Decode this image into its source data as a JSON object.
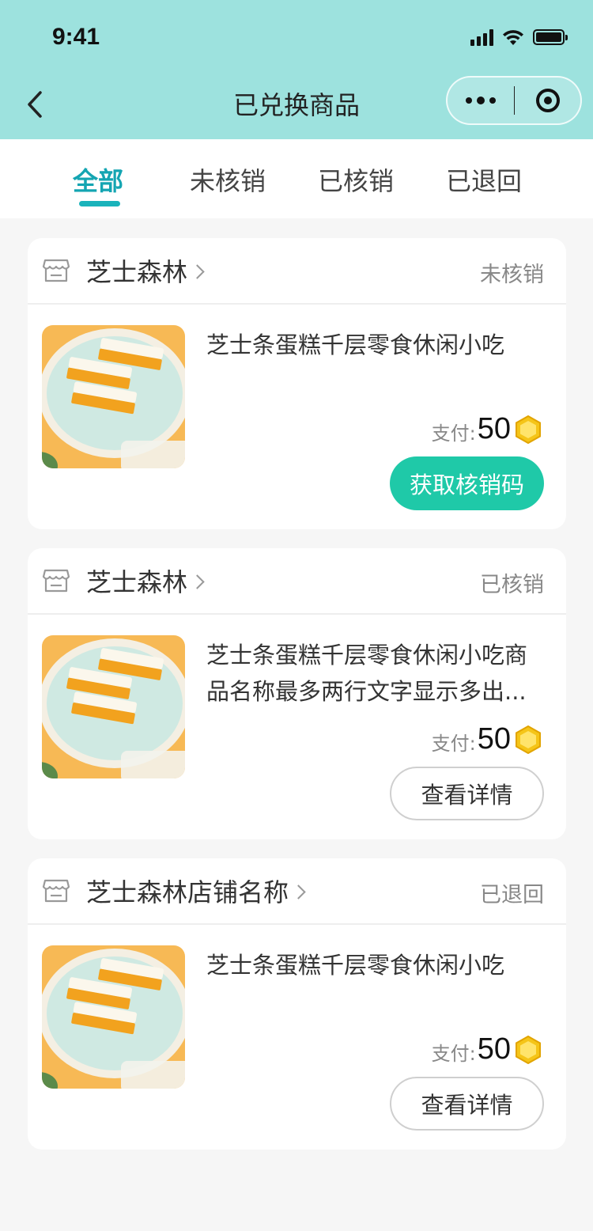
{
  "status_bar": {
    "time": "9:41"
  },
  "nav": {
    "title": "已兑换商品"
  },
  "tabs": [
    {
      "label": "全部",
      "active": true
    },
    {
      "label": "未核销",
      "active": false
    },
    {
      "label": "已核销",
      "active": false
    },
    {
      "label": "已退回",
      "active": false
    }
  ],
  "orders": [
    {
      "store": "芝士森林",
      "status": "未核销",
      "product_title": "芝士条蛋糕千层零食休闲小吃",
      "pay_label": "支付:",
      "pay_amount": "50",
      "action_label": "获取核销码"
    },
    {
      "store": "芝士森林",
      "status": "已核销",
      "product_title": "芝士条蛋糕千层零食休闲小吃商品名称最多两行文字显示多出...",
      "pay_label": "支付:",
      "pay_amount": "50",
      "action_label": "查看详情"
    },
    {
      "store": "芝士森林店铺名称",
      "status": "已退回",
      "product_title": "芝士条蛋糕千层零食休闲小吃",
      "pay_label": "支付:",
      "pay_amount": "50",
      "action_label": "查看详情"
    }
  ],
  "colors": {
    "header_bg": "#9de2de",
    "tab_active": "#14a5b2",
    "primary_button": "#1fc9a8",
    "coin": "#f5c518"
  },
  "icons": {
    "back": "chevron-left-icon",
    "more": "more-dots-icon",
    "close": "target-icon",
    "store": "store-icon",
    "coin": "coin-icon"
  }
}
